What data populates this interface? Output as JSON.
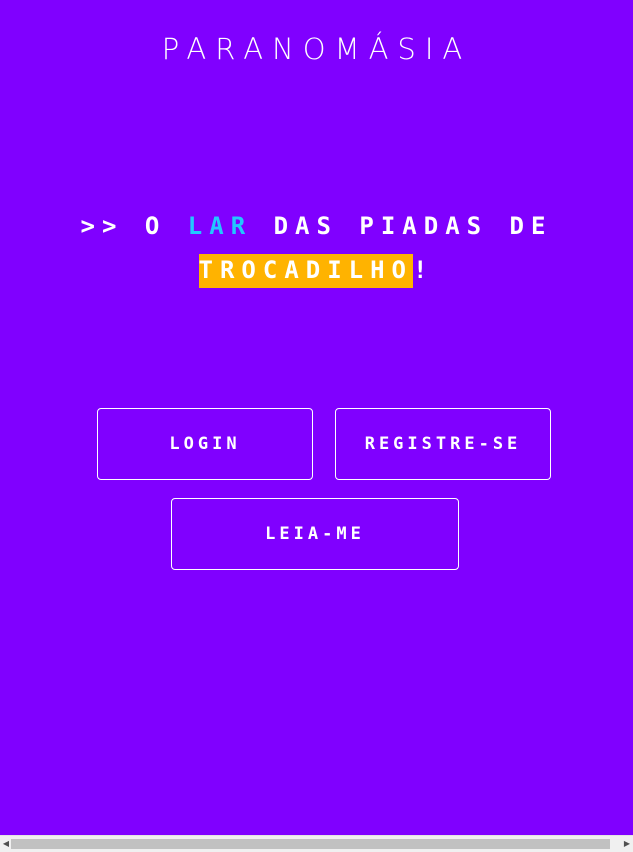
{
  "brand": {
    "title": "PARANOMÁSIA"
  },
  "tagline": {
    "prefix": ">> o ",
    "highlight_word": "lar",
    "middle": " das piadas de",
    "boxed_word": "trocadilho",
    "suffix": "!"
  },
  "buttons": {
    "login": "Login",
    "register": "Registre-se",
    "readme": "Leia-me"
  },
  "colors": {
    "background": "#8000ff",
    "highlight_text": "#22c7ff",
    "highlight_box": "#ffb300",
    "text": "#ffffff"
  },
  "scrollbar": {
    "left_arrow_icon": "triangle-left",
    "right_arrow_icon": "triangle-right"
  }
}
